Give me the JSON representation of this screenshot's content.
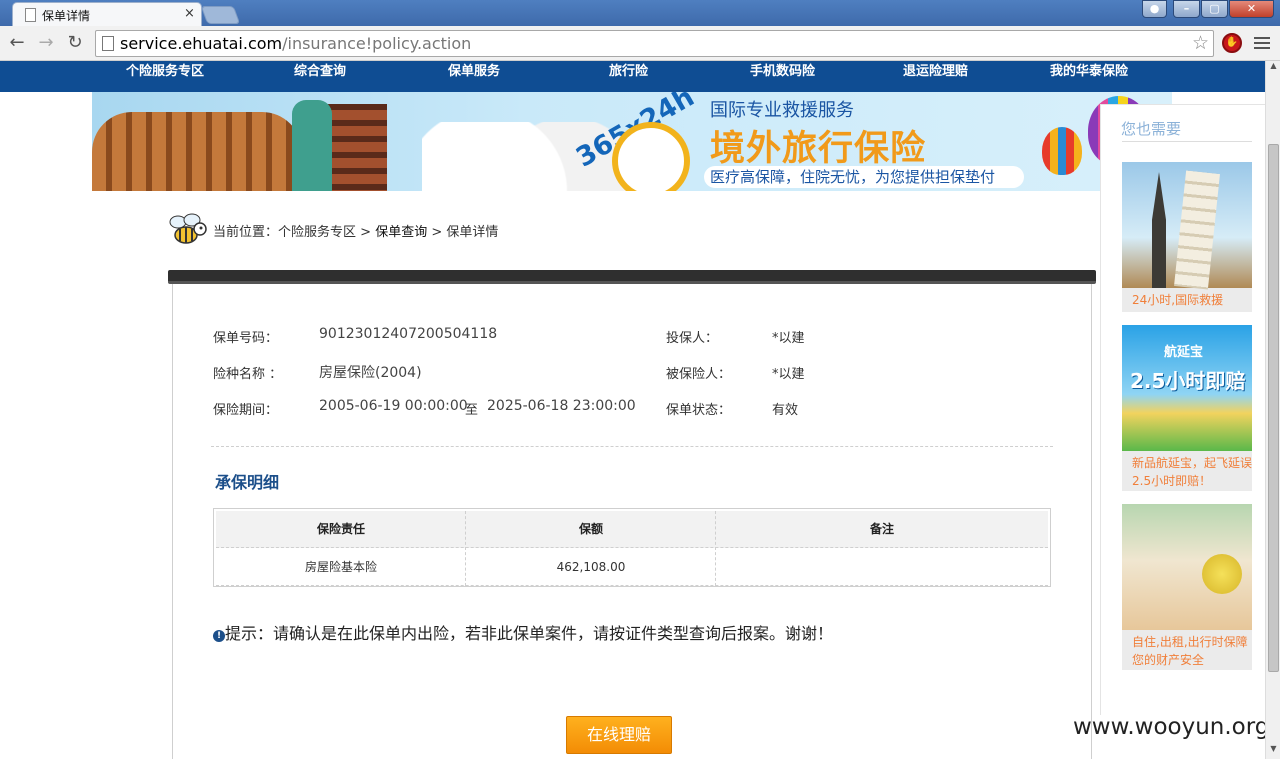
{
  "browser": {
    "tab_title": "保单详情",
    "tab_close": "×",
    "url_host": "service.ehuatai.com",
    "url_path": "/insurance!policy.action",
    "back_glyph": "←",
    "forward_glyph": "→",
    "reload_glyph": "↻",
    "star_glyph": "☆"
  },
  "nav": {
    "items": [
      "个险服务专区",
      "综合查询",
      "保单服务",
      "旅行险",
      "手机数码险",
      "退运险理赔",
      "我的华泰保险"
    ]
  },
  "banner": {
    "badge": "365x24h",
    "line1": "国际专业救援服务",
    "line2": "境外旅行保险",
    "line3": "医疗高保障，住院无忧，为您提供担保垫付"
  },
  "breadcrumb": {
    "prefix": "当前位置：",
    "item1": "个险服务专区",
    "sep1": " > ",
    "item2": "保单查询",
    "sep2": " > ",
    "item3": "保单详情"
  },
  "policy": {
    "no_label": "保单号码：",
    "no_value": "90123012407200504118",
    "holder_label": "投保人：",
    "holder_value": "*以建",
    "product_label": "险种名称 ：",
    "product_value": "房屋保险(2004)",
    "insured_label": "被保险人：",
    "insured_value": "*以建",
    "period_label": "保险期间：",
    "period_start": "2005-06-19 00:00:00",
    "period_to": "至",
    "period_end": "2025-06-18 23:00:00",
    "status_label": "保单状态：",
    "status_value": "有效"
  },
  "coverage": {
    "title": "承保明细",
    "headers": [
      "保险责任",
      "保额",
      "备注"
    ],
    "rows": [
      [
        "房屋险基本险",
        "462,108.00",
        ""
      ]
    ]
  },
  "tip": {
    "icon": "!",
    "text": "提示：请确认是在此保单内出险，若非此保单案件，请按证件类型查询后报案。谢谢！"
  },
  "claim_button": "在线理赔",
  "sidebar": {
    "title": "您也需要",
    "cards": [
      {
        "caption": "24小时,国际救援"
      },
      {
        "img_line1": "航延宝",
        "img_line2": "2.5小时即赔",
        "caption_line1": "新品航延宝，起飞延误",
        "caption_line2": "2.5小时即赔！"
      },
      {
        "caption_line1": "自住,出租,出行时保障",
        "caption_line2": "您的财产安全"
      }
    ]
  },
  "watermark": "www.wooyun.org",
  "colors": {
    "nav_bg": "#0f4d93",
    "accent_orange": "#f38c05",
    "section_title": "#1c4f8a",
    "sidebar_caption": "#f07f3a"
  }
}
